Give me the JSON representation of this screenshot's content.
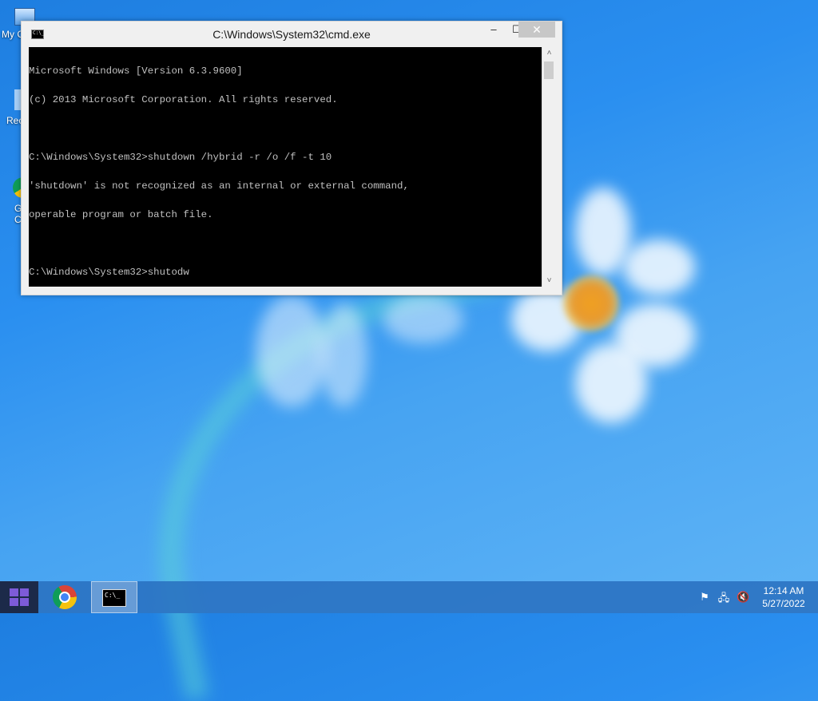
{
  "desktop": {
    "icons": [
      {
        "label": "My C"
      },
      {
        "label": "Rec"
      },
      {
        "label": "G\nC"
      }
    ]
  },
  "window": {
    "title": "C:\\Windows\\System32\\cmd.exe",
    "controls": {
      "minimize": "‒",
      "maximize": "☐",
      "close": "✕"
    },
    "console_lines": [
      "Microsoft Windows [Version 6.3.9600]",
      "(c) 2013 Microsoft Corporation. All rights reserved.",
      "",
      "C:\\Windows\\System32>shutdown /hybrid -r /o /f -t 10",
      "'shutdown' is not recognized as an internal or external command,",
      "operable program or batch file.",
      "",
      "C:\\Windows\\System32>shutodw"
    ],
    "app_icon_text": "C:\\_"
  },
  "taskbar": {
    "pinned": [
      "chrome-icon",
      "cmd-icon"
    ],
    "cmd_icon_text": "C:\\_",
    "tray": [
      "flag-icon",
      "network-icon",
      "volume-muted-icon"
    ],
    "time": "12:14 AM",
    "date": "5/27/2022"
  },
  "colors": {
    "console_bg": "#000000",
    "console_fg": "#c0c0c0",
    "start_accent": "#7d5bd8"
  }
}
